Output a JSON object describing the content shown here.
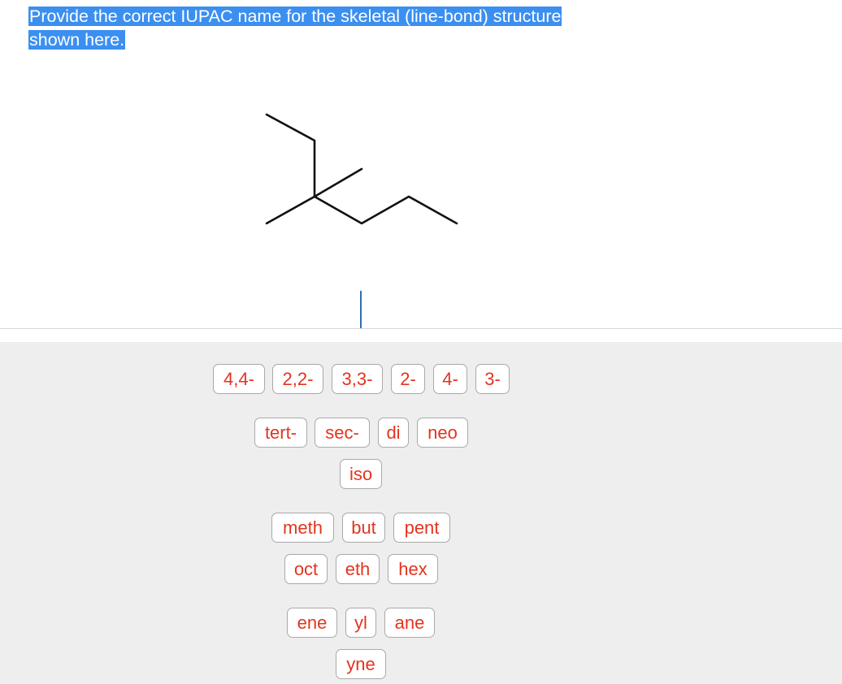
{
  "question": {
    "line1": "Provide the correct IUPAC name for the skeletal (line-bond) structure",
    "line2": "shown here."
  },
  "answer": {
    "value": ""
  },
  "tiles": {
    "locants": [
      "4,4-",
      "2,2-",
      "3,3-",
      "2-",
      "4-",
      "3-"
    ],
    "prefixes": [
      "tert-",
      "sec-",
      "di",
      "neo"
    ],
    "prefixes2": [
      "iso"
    ],
    "roots1": [
      "meth",
      "but",
      "pent"
    ],
    "roots2": [
      "oct",
      "eth",
      "hex"
    ],
    "suffixes1": [
      "ene",
      "yl",
      "ane"
    ],
    "suffixes2": [
      "yne"
    ]
  },
  "colors": {
    "highlight": "#3b8ff0",
    "tile_text": "#e3341f",
    "panel_bg": "#eeeeee",
    "cursor": "#2f6fb0"
  }
}
